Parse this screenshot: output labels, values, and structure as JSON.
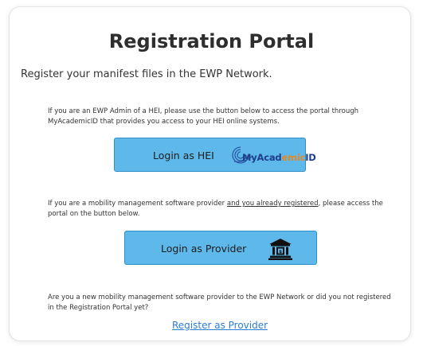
{
  "title": "Registration Portal",
  "subtitle": "Register your manifest files in the EWP Network.",
  "hei_section": {
    "text": "If you are an EWP Admin of a HEI, please use the button below to access the portal through MyAcademicID that provides you access to your HEI online systems.",
    "button_label": "Login as HEI",
    "logo_text_part1": "MyAcad",
    "logo_text_part2": "emic",
    "logo_text_part3": "ID"
  },
  "provider_section": {
    "text_before": "If you are a mobility management software provider ",
    "text_underlined": "and you already registered",
    "text_after": ", please access the portal on the button below.",
    "button_label": "Login as Provider"
  },
  "new_provider_section": {
    "text": "Are you a new mobility management software provider to the EWP Network or did you not registered in the Registration Portal yet?",
    "link_label": "Register as Provider"
  },
  "colors": {
    "button_bg": "#5eb8ea",
    "button_border": "#2f8fc9",
    "link": "#2b7ed6",
    "logo_blue": "#1e3e8c",
    "logo_orange": "#e28a28"
  },
  "icons": {
    "hei_logo": "myacademicid-logo",
    "provider_icon": "bank-building-icon"
  }
}
